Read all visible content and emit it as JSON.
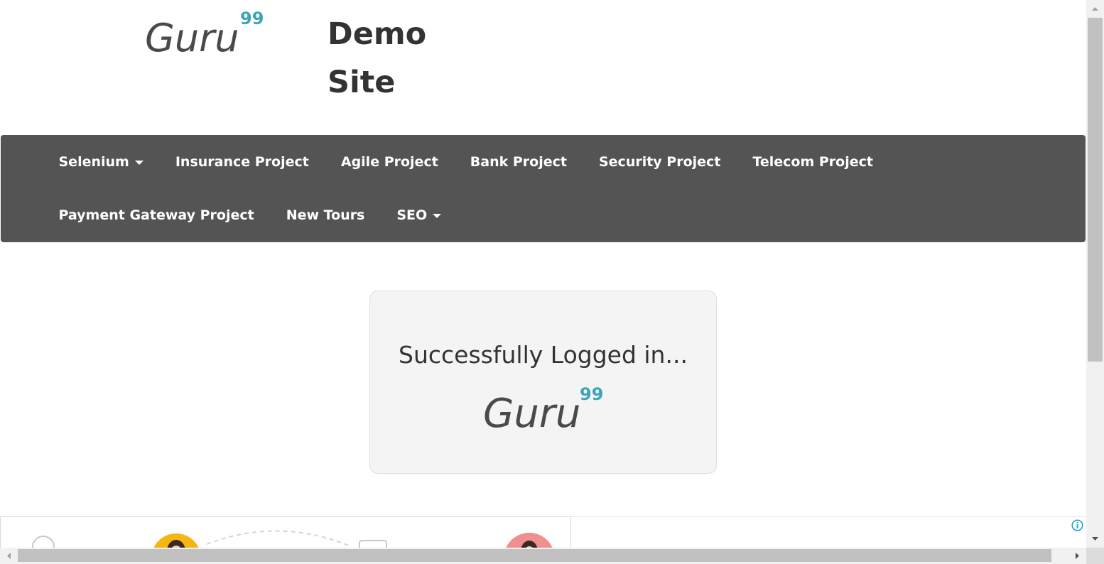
{
  "header": {
    "logo": {
      "text": "Guru",
      "superscript": "99",
      "text_color": "#4a4a4a",
      "superscript_color": "#3ea4b9"
    },
    "title_line1": "Demo",
    "title_line2": "Site"
  },
  "navbar": {
    "background": "#545454",
    "row1": [
      {
        "label": "Selenium",
        "dropdown": true
      },
      {
        "label": "Insurance Project",
        "dropdown": false
      },
      {
        "label": "Agile Project",
        "dropdown": false
      },
      {
        "label": "Bank Project",
        "dropdown": false
      },
      {
        "label": "Security Project",
        "dropdown": false
      },
      {
        "label": "Telecom Project",
        "dropdown": false
      }
    ],
    "row2": [
      {
        "label": "Payment Gateway Project",
        "dropdown": false
      },
      {
        "label": "New Tours",
        "dropdown": false
      },
      {
        "label": "SEO",
        "dropdown": true
      }
    ]
  },
  "card": {
    "message": "Successfully Logged in...",
    "logo": {
      "text": "Guru",
      "superscript": "99"
    }
  },
  "icons": {
    "info": "info-icon",
    "scroll_up": "chevron-up-icon",
    "scroll_down": "chevron-down-icon",
    "scroll_left": "chevron-left-icon",
    "scroll_right": "chevron-right-icon"
  }
}
